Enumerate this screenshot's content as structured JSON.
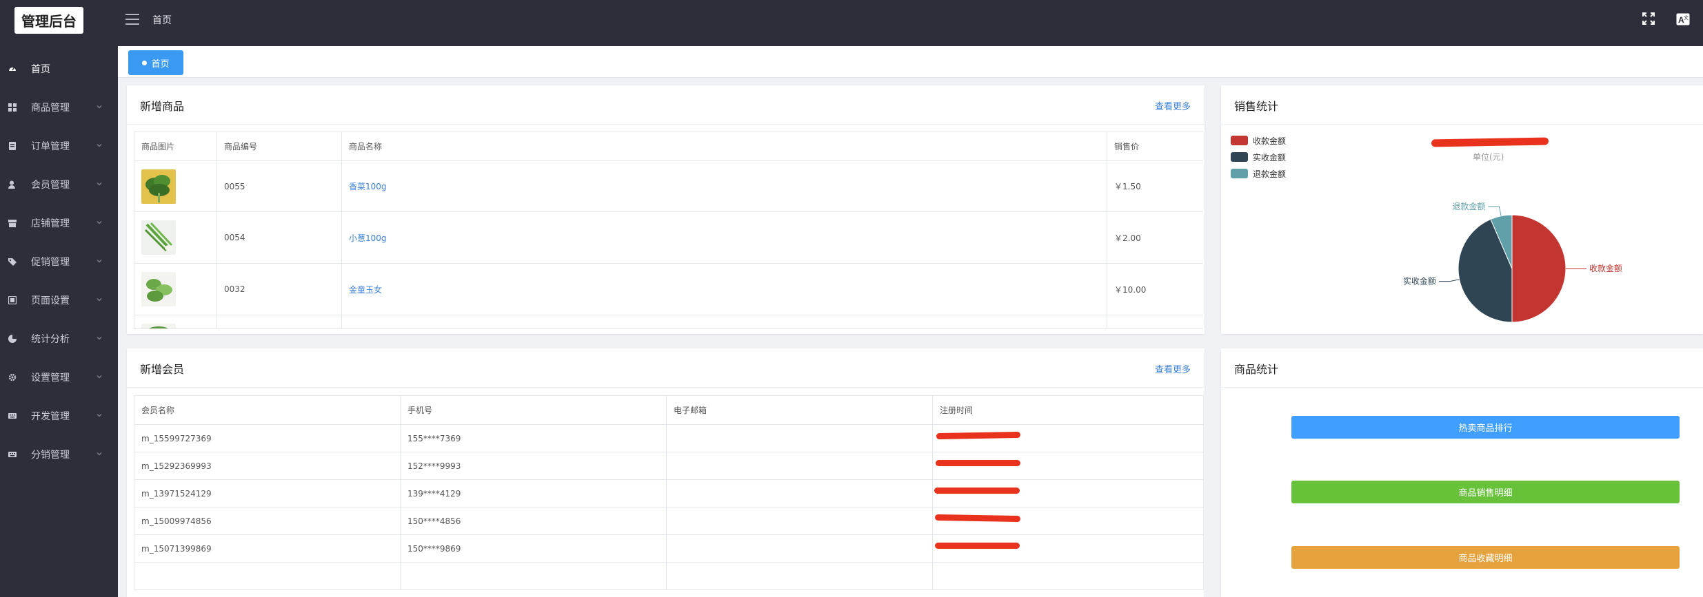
{
  "app": {
    "logo_text": "管理后台"
  },
  "topbar": {
    "breadcrumb": "首页"
  },
  "sidebar": {
    "items": [
      {
        "label": "首页",
        "icon": "dashboard-icon",
        "active": true
      },
      {
        "label": "商品管理",
        "icon": "grid-icon"
      },
      {
        "label": "订单管理",
        "icon": "order-icon"
      },
      {
        "label": "会员管理",
        "icon": "member-icon"
      },
      {
        "label": "店铺管理",
        "icon": "store-icon"
      },
      {
        "label": "促销管理",
        "icon": "tag-icon"
      },
      {
        "label": "页面设置",
        "icon": "page-icon"
      },
      {
        "label": "统计分析",
        "icon": "pie-icon"
      },
      {
        "label": "设置管理",
        "icon": "gear-icon"
      },
      {
        "label": "开发管理",
        "icon": "keyboard-icon"
      },
      {
        "label": "分销管理",
        "icon": "keyboard-icon"
      }
    ]
  },
  "tabs": {
    "home_label": "首页"
  },
  "new_products": {
    "title": "新增商品",
    "more": "查看更多",
    "columns": [
      "商品图片",
      "商品编号",
      "商品名称",
      "销售价"
    ],
    "rows": [
      {
        "code": "0055",
        "name": "香菜100g",
        "price": "￥1.50",
        "image": "cilantro"
      },
      {
        "code": "0054",
        "name": "小葱100g",
        "price": "￥2.00",
        "image": "scallion"
      },
      {
        "code": "0032",
        "name": "金童玉女",
        "price": "￥10.00",
        "image": "cucumber"
      }
    ]
  },
  "sales_stats": {
    "title": "销售统计",
    "unit": "单位(元)",
    "legend": [
      "收款金额",
      "实收金额",
      "退款金额"
    ],
    "colors": {
      "received": "#c23531",
      "actual": "#2f4554",
      "refund": "#61a0a8"
    }
  },
  "chart_data": {
    "type": "pie",
    "title": "",
    "subtitle": "单位(元)",
    "legend_position": "top-left",
    "slices": [
      {
        "name": "收款金额",
        "value": 50,
        "color": "#c23531"
      },
      {
        "name": "实收金额",
        "value": 43.5,
        "color": "#2f4554"
      },
      {
        "name": "退款金额",
        "value": 6.5,
        "color": "#61a0a8"
      }
    ]
  },
  "new_members": {
    "title": "新增会员",
    "more": "查看更多",
    "columns": [
      "会员名称",
      "手机号",
      "电子邮箱",
      "注册时间"
    ],
    "rows": [
      {
        "name": "m_15599727369",
        "phone": "155****7369",
        "email": ""
      },
      {
        "name": "m_15292369993",
        "phone": "152****9993",
        "email": ""
      },
      {
        "name": "m_13971524129",
        "phone": "139****4129",
        "email": ""
      },
      {
        "name": "m_15009974856",
        "phone": "150****4856",
        "email": ""
      },
      {
        "name": "m_15071399869",
        "phone": "150****9869",
        "email": ""
      }
    ]
  },
  "product_stats": {
    "title": "商品统计",
    "buttons": [
      {
        "label": "热卖商品排行",
        "color": "#409eff"
      },
      {
        "label": "商品销售明细",
        "color": "#67c23a"
      },
      {
        "label": "商品收藏明细",
        "color": "#e6a23c"
      }
    ]
  }
}
